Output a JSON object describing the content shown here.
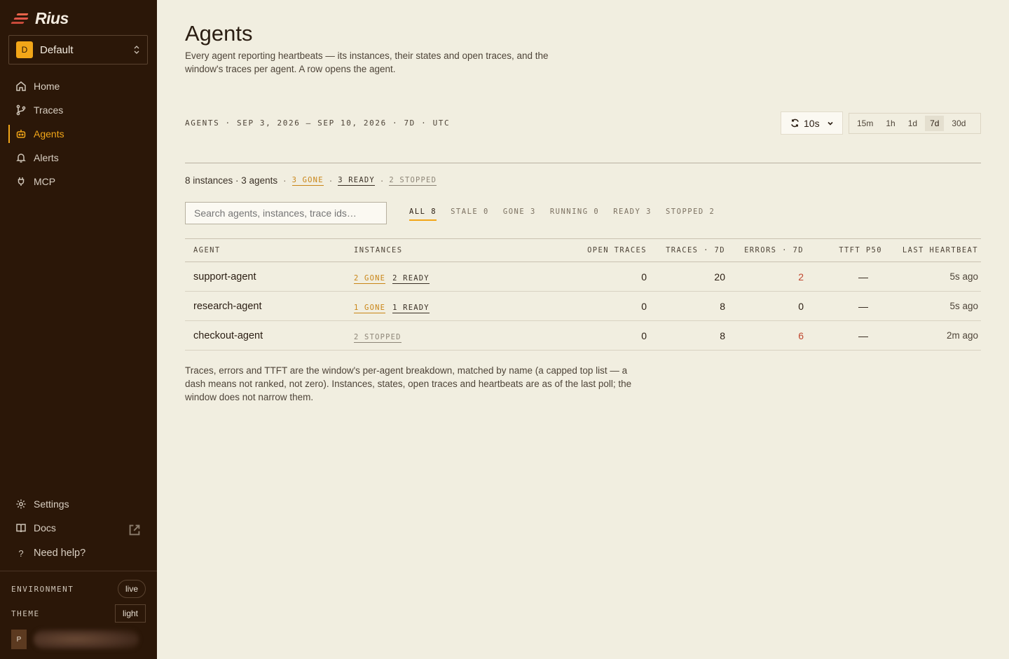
{
  "app": {
    "name": "Rius"
  },
  "workspace": {
    "badge": "D",
    "name": "Default"
  },
  "nav": [
    {
      "label": "Home",
      "icon": "home-icon"
    },
    {
      "label": "Traces",
      "icon": "traces-icon"
    },
    {
      "label": "Agents",
      "icon": "agents-icon",
      "active": true
    },
    {
      "label": "Alerts",
      "icon": "bell-icon"
    },
    {
      "label": "MCP",
      "icon": "plug-icon"
    }
  ],
  "nav_bottom": {
    "settings": "Settings",
    "docs": "Docs",
    "help": "Need help?"
  },
  "environment": {
    "label": "ENVIRONMENT",
    "value": "live"
  },
  "theme": {
    "label": "THEME",
    "value": "light"
  },
  "user": {
    "initial": "P"
  },
  "page": {
    "title": "Agents",
    "description": "Every agent reporting heartbeats — its instances, their states and open traces, and the window's traces per agent. A row opens the agent.",
    "range_label": "AGENTS · SEP 3, 2026 – SEP 10, 2026 · 7D · UTC",
    "refresh": "10s",
    "ranges": [
      "15m",
      "1h",
      "1d",
      "7d",
      "30d"
    ],
    "selected_range": "7d"
  },
  "summary": {
    "counts": "8 instances · 3 agents",
    "gone": "3 GONE",
    "ready": "3 READY",
    "stopped": "2 STOPPED"
  },
  "search": {
    "placeholder": "Search agents, instances, trace ids…"
  },
  "filters": [
    {
      "label": "ALL 8",
      "active": true
    },
    {
      "label": "STALE 0"
    },
    {
      "label": "GONE 3"
    },
    {
      "label": "RUNNING 0"
    },
    {
      "label": "READY 3"
    },
    {
      "label": "STOPPED 2"
    }
  ],
  "table": {
    "headers": {
      "agent": "AGENT",
      "instances": "INSTANCES",
      "open_traces": "OPEN TRACES",
      "traces": "TRACES · 7D",
      "errors": "ERRORS · 7D",
      "ttft": "TTFT P50",
      "heartbeat": "LAST HEARTBEAT"
    },
    "rows": [
      {
        "agent": "support-agent",
        "gone": "2 GONE",
        "ready": "2 READY",
        "stopped": "",
        "open_traces": "0",
        "traces": "20",
        "errors": "2",
        "ttft": "—",
        "heartbeat": "5s ago"
      },
      {
        "agent": "research-agent",
        "gone": "1 GONE",
        "ready": "1 READY",
        "stopped": "",
        "open_traces": "0",
        "traces": "8",
        "errors": "0",
        "ttft": "—",
        "heartbeat": "5s ago"
      },
      {
        "agent": "checkout-agent",
        "gone": "",
        "ready": "",
        "stopped": "2 STOPPED",
        "open_traces": "0",
        "traces": "8",
        "errors": "6",
        "ttft": "—",
        "heartbeat": "2m ago"
      }
    ]
  },
  "footnote": "Traces, errors and TTFT are the window's per-agent breakdown, matched by name (a capped top list — a dash means not ranked, not zero). Instances, states, open traces and heartbeats are as of the last poll; the window does not narrow them.",
  "colors": {
    "sidebar": "#2b1708",
    "accent": "#f2a618",
    "background": "#f1eee0",
    "error": "#c0472f"
  }
}
